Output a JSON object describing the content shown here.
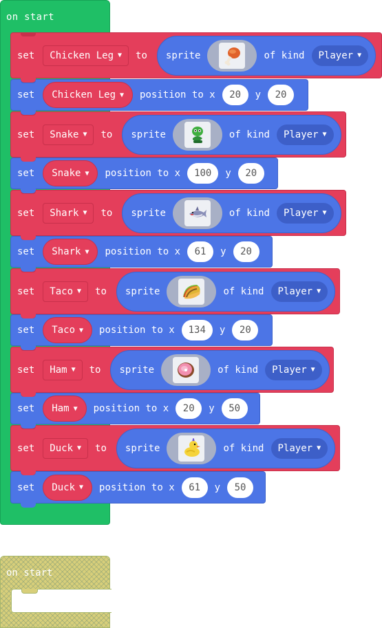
{
  "hat": {
    "label": "on start"
  },
  "words": {
    "set": "set",
    "to": "to",
    "sprite": "sprite",
    "of_kind": "of kind",
    "position_to_x": "position to x",
    "y": "y"
  },
  "sprites": [
    {
      "var": "Chicken Leg",
      "kind": "Player",
      "icon": "chicken-leg-icon",
      "x": "20",
      "y": "20"
    },
    {
      "var": "Snake",
      "kind": "Player",
      "icon": "snake-icon",
      "x": "100",
      "y": "20"
    },
    {
      "var": "Shark",
      "kind": "Player",
      "icon": "shark-icon",
      "x": "61",
      "y": "20"
    },
    {
      "var": "Taco",
      "kind": "Player",
      "icon": "taco-icon",
      "x": "134",
      "y": "20"
    },
    {
      "var": "Ham",
      "kind": "Player",
      "icon": "ham-icon",
      "x": "20",
      "y": "50"
    },
    {
      "var": "Duck",
      "kind": "Player",
      "icon": "duck-icon",
      "x": "61",
      "y": "50"
    }
  ],
  "ghost": {
    "label": "on start"
  },
  "colors": {
    "event": "#1fbf66",
    "variable": "#e43e5b",
    "sprite": "#4c75e6",
    "ghost": "#d8cf7a"
  }
}
